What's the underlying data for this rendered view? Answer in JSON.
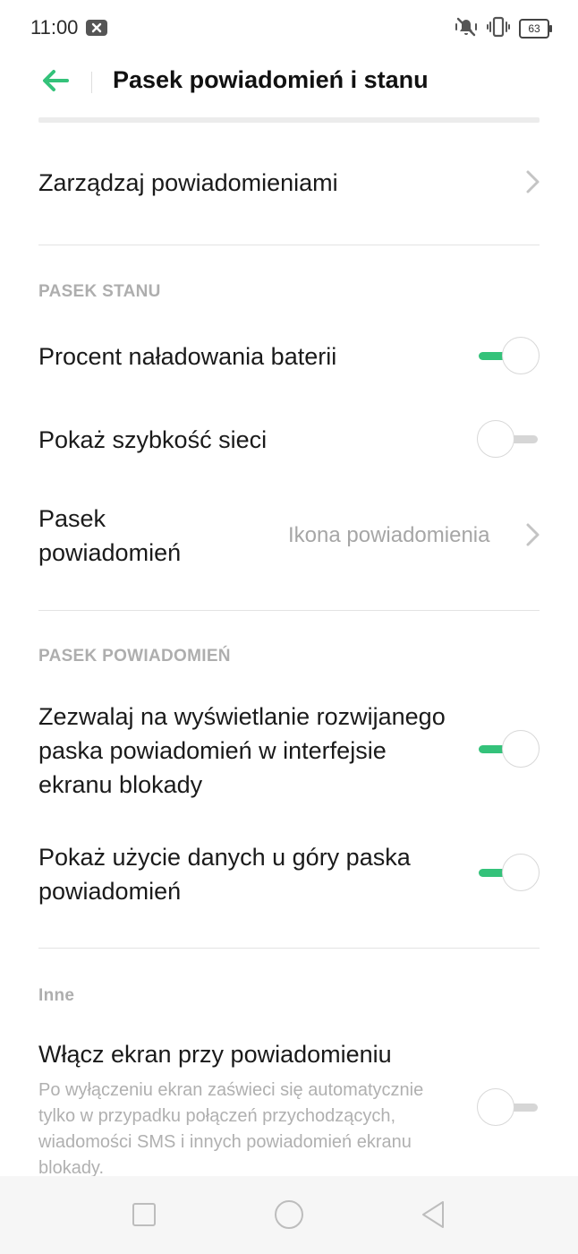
{
  "status_bar": {
    "time": "11:00",
    "icons": [
      "notification-box-icon",
      "mute-icon",
      "vibrate-icon",
      "battery-icon"
    ],
    "battery": "63"
  },
  "header": {
    "title": "Pasek powiadomień i stanu",
    "back_icon": "arrow-left-icon"
  },
  "items": {
    "manage_notifications": {
      "label": "Zarządzaj powiadomieniami"
    },
    "battery_percent": {
      "label": "Procent naładowania baterii",
      "enabled": true
    },
    "network_speed": {
      "label": "Pokaż szybkość sieci",
      "enabled": false
    },
    "notification_bar": {
      "label": "Pasek powiadomień",
      "value": "Ikona powiadomienia"
    },
    "allow_lockscreen": {
      "label": "Zezwalaj na wyświetlanie rozwijanego paska powiadomień w interfejsie ekranu blokady",
      "enabled": true
    },
    "data_usage": {
      "label": "Pokaż użycie danych u góry paska powiadomień",
      "enabled": true
    },
    "wake_screen": {
      "label": "Włącz ekran przy powiadomieniu",
      "description": "Po wyłączeniu ekran zaświeci się automatycznie tylko w przypadku połączeń przychodzących, wiadomości SMS i innych powiadomień ekranu blokady.",
      "enabled": false
    }
  },
  "sections": {
    "status_bar": "PASEK STANU",
    "notification_bar": "PASEK POWIADOMIEŃ",
    "other": "Inne"
  },
  "nav_bar": {
    "icons": [
      "recent-apps-icon",
      "home-icon",
      "back-icon"
    ]
  },
  "colors": {
    "accent": "#34c27a",
    "toggle_off_track": "#d6d6d6",
    "secondary_text": "#a6a6a6",
    "section_header": "#aeaeae"
  }
}
